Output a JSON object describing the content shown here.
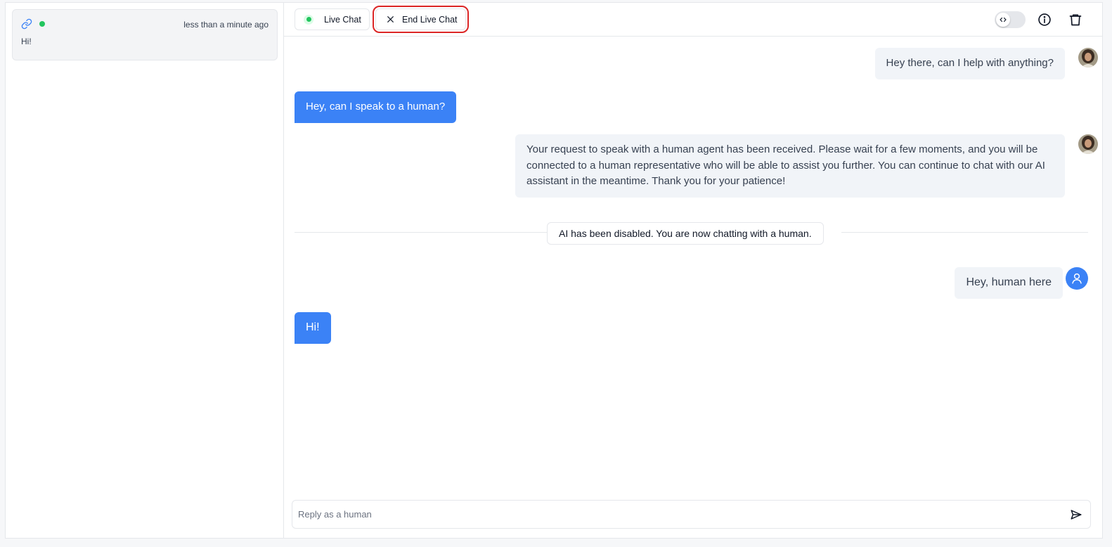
{
  "sidebar": {
    "conversation": {
      "time": "less than a minute ago",
      "preview": "Hi!",
      "status_color": "#22c55e"
    }
  },
  "topbar": {
    "live_chat_label": "Live Chat",
    "end_live_chat_label": "End Live Chat"
  },
  "messages": [
    {
      "role": "assistant",
      "text": "Hey there, can I help with anything?"
    },
    {
      "role": "user",
      "text": "Hey, can I speak to a human?"
    },
    {
      "role": "assistant",
      "text": "Your request to speak with a human agent has been received. Please wait for a few moments, and you will be connected to a human representative who will be able to assist you further. You can continue to chat with our AI assistant in the meantime. Thank you for your patience!"
    },
    {
      "role": "system",
      "text": "AI has been disabled. You are now chatting with a human."
    },
    {
      "role": "human_agent",
      "text": "Hey, human here"
    },
    {
      "role": "user",
      "text": "Hi!"
    }
  ],
  "composer": {
    "placeholder": "Reply as a human"
  },
  "colors": {
    "accent": "#3b82f6",
    "online": "#22c55e",
    "highlight": "#dc2626"
  }
}
